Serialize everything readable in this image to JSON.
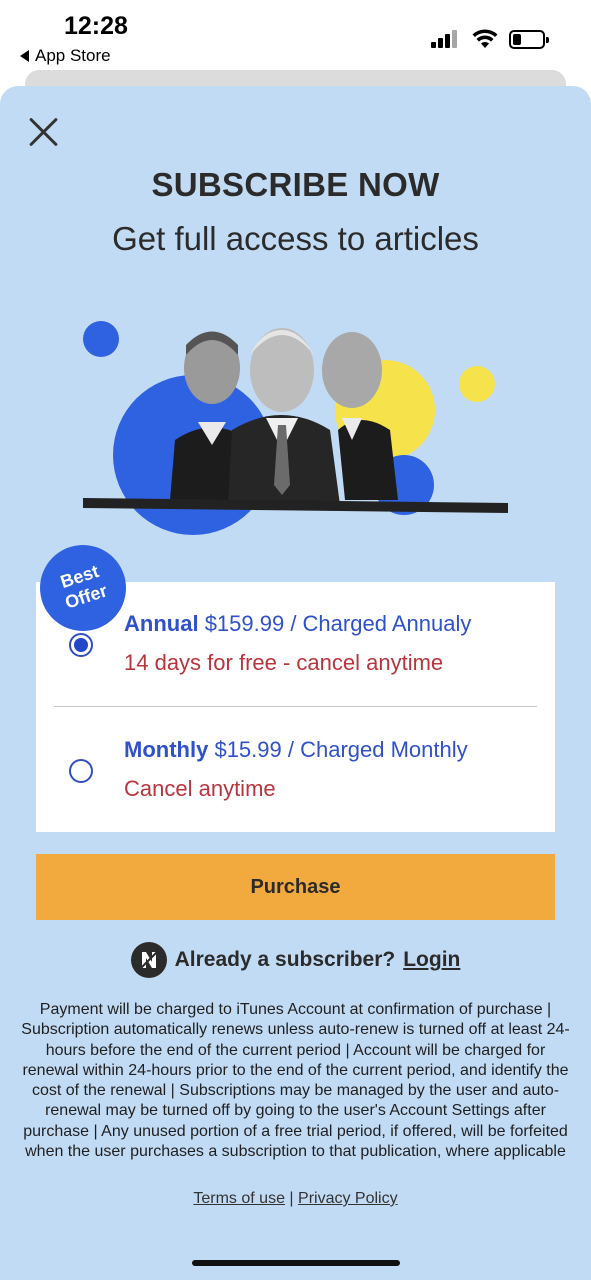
{
  "status_bar": {
    "time": "12:28",
    "back_app_label": "App Store"
  },
  "header": {
    "close_icon": "close-icon",
    "title": "SUBSCRIBE NOW",
    "subtitle": "Get full access to articles"
  },
  "badge": {
    "line1": "Best",
    "line2": "Offer"
  },
  "plans": [
    {
      "name": "Annual",
      "price_text": "$159.99 / Charged Annualy",
      "note": "14 days for free - cancel anytime",
      "selected": true
    },
    {
      "name": "Monthly",
      "price_text": "$15.99 / Charged Monthly",
      "note": "Cancel anytime",
      "selected": false
    }
  ],
  "purchase_label": "Purchase",
  "login": {
    "prompt": "Already a subscriber?",
    "link_label": "Login"
  },
  "legal_text": "Payment will be charged to iTunes Account at confirmation of purchase | Subscription automatically renews unless auto-renew is turned off at least 24-hours before the end of the current period | Account will be charged for renewal within 24-hours prior to the end of the current period, and identify the cost of the renewal | Subscriptions may be managed by the user and auto-renewal may be turned off by going to the user's Account Settings after purchase | Any unused portion of a free trial period, if offered, will be forfeited when the user purchases a subscription to that publication, where applicable",
  "footer_links": {
    "terms": "Terms of use",
    "separator": "|",
    "privacy": "Privacy Policy"
  },
  "colors": {
    "sheet_bg": "#c2dbf4",
    "accent_blue": "#2f51c9",
    "note_red": "#b8353d",
    "purchase_orange": "#f2a93d",
    "badge_blue": "#2f62e0",
    "hero_yellow": "#f6e24a"
  }
}
